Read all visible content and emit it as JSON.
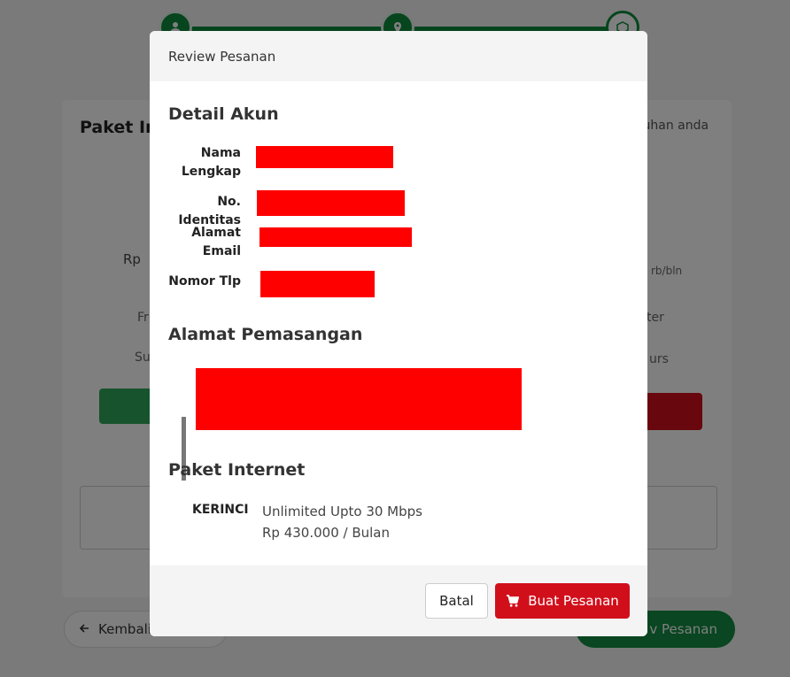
{
  "background": {
    "page_title": "Paket Int",
    "hint_text": "tuhan anda",
    "price_prefix": "Rp",
    "price_suffix": "rb/bln",
    "feature_left_1": "Fr",
    "feature_left_2": "Su",
    "feature_right_1": "ter",
    "feature_right_2": "urs",
    "back_label": "Kembali",
    "submit_label": "v Pesanan",
    "colors": {
      "brand_green": "#0f8a3c",
      "brand_red": "#d10f1b"
    }
  },
  "modal": {
    "title": "Review Pesanan",
    "account_section": {
      "heading": "Detail Akun",
      "fields": [
        {
          "label": "Nama Lengkap",
          "value": ""
        },
        {
          "label": "No. Identitas",
          "value": ""
        },
        {
          "label": "Alamat Email",
          "value": ""
        },
        {
          "label": "Nomor Tlp",
          "value": ""
        }
      ]
    },
    "address_section": {
      "heading": "Alamat Pemasangan",
      "value": ""
    },
    "package_section": {
      "heading": "Paket Internet",
      "region": "KERINCI",
      "plan_name": "Unlimited Upto 30 Mbps",
      "plan_price": "Rp 430.000 / Bulan"
    },
    "footer": {
      "cancel_label": "Batal",
      "confirm_label": "Buat Pesanan",
      "confirm_icon": "cart-icon"
    },
    "redaction_color": "#ff0000"
  }
}
